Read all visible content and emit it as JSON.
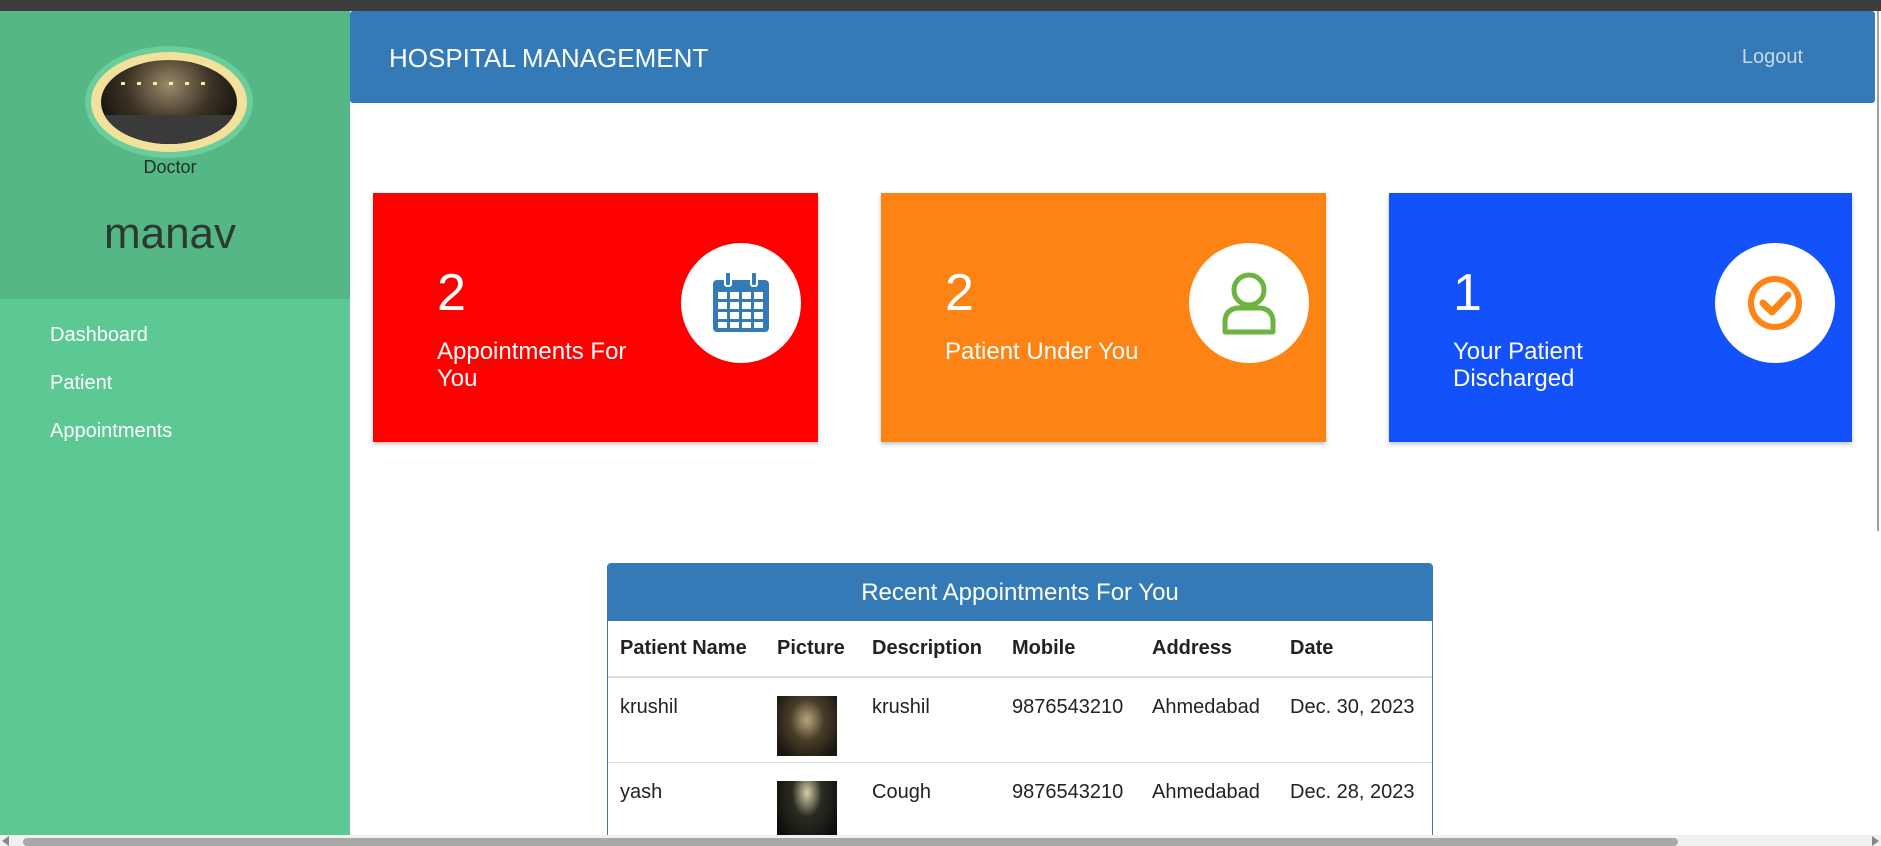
{
  "sidebar": {
    "role": "Doctor",
    "username": "manav",
    "items": [
      {
        "label": "Dashboard"
      },
      {
        "label": "Patient"
      },
      {
        "label": "Appointments"
      }
    ]
  },
  "header": {
    "brand": "HOSPITAL MANAGEMENT",
    "logout": "Logout"
  },
  "cards": [
    {
      "value": "2",
      "label": "Appointments For You",
      "color": "#ff0000",
      "icon": "calendar-icon"
    },
    {
      "value": "2",
      "label": "Patient Under You",
      "color": "#fd8314",
      "icon": "user-icon"
    },
    {
      "value": "1",
      "label": "Your Patient Discharged",
      "color": "#1351fb",
      "icon": "check-circle-icon"
    }
  ],
  "appointments": {
    "title": "Recent Appointments For You",
    "columns": [
      "Patient Name",
      "Picture",
      "Description",
      "Mobile",
      "Address",
      "Date"
    ],
    "rows": [
      {
        "name": "krushil",
        "description": "krushil",
        "mobile": "9876543210",
        "address": "Ahmedabad",
        "date": "Dec. 30, 2023"
      },
      {
        "name": "yash",
        "description": "Cough",
        "mobile": "9876543210",
        "address": "Ahmedabad",
        "date": "Dec. 28, 2023"
      }
    ]
  },
  "colors": {
    "sidebar": "#5cc994",
    "sidebar_top": "#55b686",
    "header": "#337ab7"
  }
}
